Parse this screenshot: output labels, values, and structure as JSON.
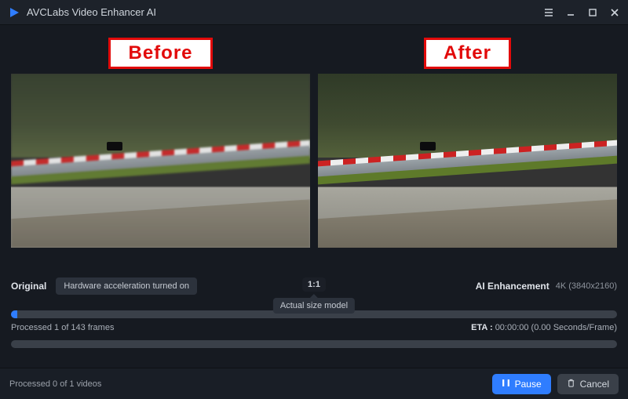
{
  "app": {
    "title": "AVCLabs Video Enhancer AI",
    "logo_color": "#2f7dff"
  },
  "annotations": {
    "before": "Before",
    "after": "After"
  },
  "labels": {
    "original": "Original",
    "hw_accel": "Hardware acceleration turned on",
    "scale_badge": "1:1",
    "actual_size": "Actual size model",
    "ai_enhance": "AI Enhancement",
    "ai_res": "4K (3840x2160)"
  },
  "progress": {
    "frames_text": "Processed 1 of 143 frames",
    "frames_pct": 1,
    "eta_label": "ETA :",
    "eta_value": "00:00:00 (0.00 Seconds/Frame)",
    "videos_text": "Processed 0 of 1 videos"
  },
  "buttons": {
    "pause": "Pause",
    "cancel": "Cancel"
  }
}
